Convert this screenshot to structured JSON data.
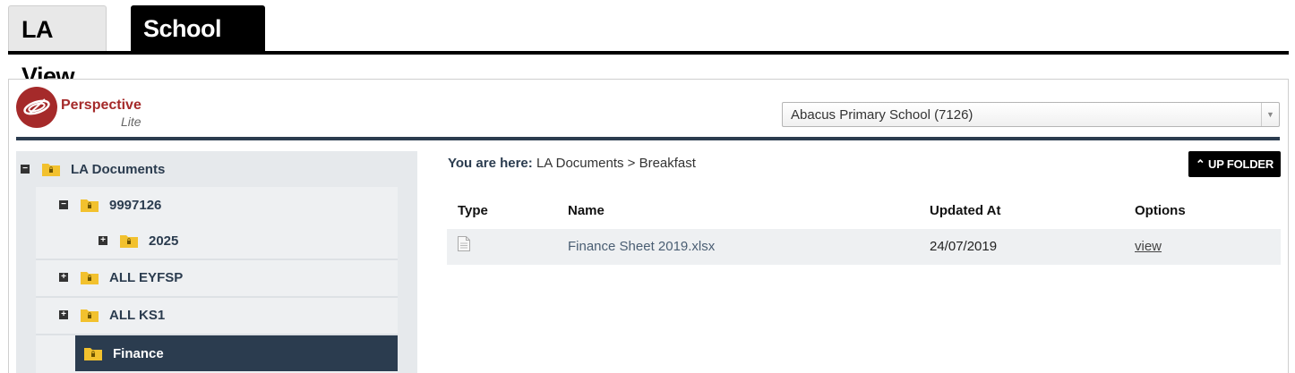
{
  "tabs": [
    {
      "label": "LA View",
      "active": false
    },
    {
      "label": "School View",
      "active": true
    }
  ],
  "logo": {
    "title": "Perspective",
    "subtitle": "Lite",
    "icon": "perspective-logo-icon"
  },
  "school_select": {
    "value": "Abacus Primary School (7126)"
  },
  "tree": {
    "root": {
      "label": "LA Documents",
      "toggle": "−"
    },
    "items": [
      {
        "label": "9997126",
        "toggle": "−"
      },
      {
        "label": "2025",
        "toggle": "+"
      },
      {
        "label": "ALL EYFSP",
        "toggle": "+"
      },
      {
        "label": "ALL KS1",
        "toggle": "+"
      },
      {
        "label": "Finance",
        "toggle": ""
      }
    ]
  },
  "breadcrumb": {
    "prefix": "You are here:",
    "path": "LA Documents > Breakfast"
  },
  "up_folder": {
    "label": "UP FOLDER",
    "icon": "chevron-up-icon"
  },
  "table": {
    "headers": {
      "type": "Type",
      "name": "Name",
      "updated": "Updated At",
      "options": "Options"
    },
    "rows": [
      {
        "type_icon": "file-icon",
        "name": "Finance Sheet 2019.xlsx",
        "updated": "24/07/2019",
        "option": "view"
      }
    ]
  },
  "colors": {
    "brand": "#a52a2a",
    "navy": "#2b3c4f",
    "folder": "#f2c12e"
  }
}
